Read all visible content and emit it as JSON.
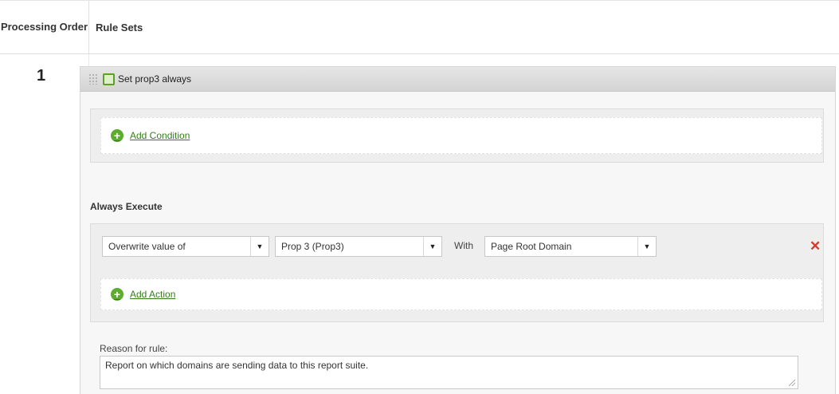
{
  "header": {
    "order_label": "Processing Order",
    "rulesets_label": "Rule Sets"
  },
  "ruleset": {
    "order": "1",
    "title": "Set prop3 always",
    "enabled": true,
    "add_condition_label": "Add Condition",
    "always_execute_label": "Always Execute",
    "action": {
      "operation": "Overwrite value of",
      "target": "Prop 3 (Prop3)",
      "with_label": "With",
      "value": "Page Root Domain"
    },
    "add_action_label": "Add Action",
    "reason_label": "Reason for rule:",
    "reason_text": "Report on which domains are sending data to this report suite."
  },
  "icons": {
    "add": "plus-circle-icon",
    "delete": "close-x-icon",
    "drag": "drag-grip-icon",
    "toggle": "checkbox-icon",
    "dropdown": "chevron-down-icon"
  },
  "colors": {
    "add_green": "#5cac2e",
    "link_green": "#3a7a1c",
    "delete_red": "#d83a2a"
  }
}
